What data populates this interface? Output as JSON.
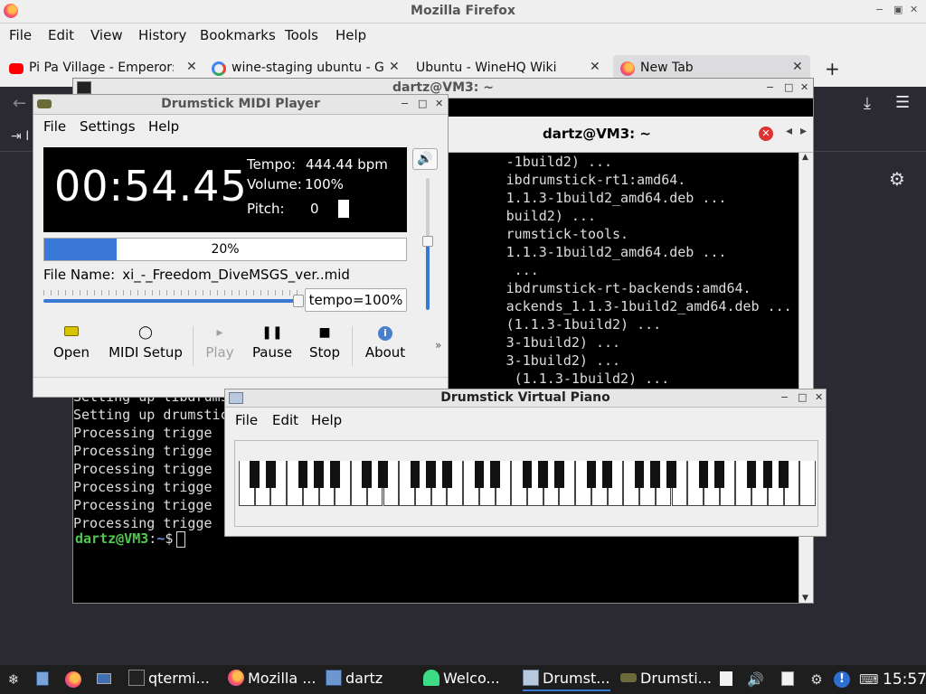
{
  "firefox": {
    "title": "Mozilla Firefox",
    "menu": [
      "File",
      "Edit",
      "View",
      "History",
      "Bookmarks",
      "Tools",
      "Help"
    ],
    "tabs": [
      {
        "label": "Pi Pa Village - Emperor: R",
        "favicon": "youtube-icon"
      },
      {
        "label": "wine-staging ubuntu - Go",
        "favicon": "google-icon"
      },
      {
        "label": "Ubuntu - WineHQ Wiki",
        "favicon": "none"
      },
      {
        "label": "New Tab",
        "favicon": "firefox-icon"
      }
    ],
    "newtab_symbol": "+",
    "import_label": "I"
  },
  "terminal": {
    "title": "dartz@VM3: ~",
    "tab_title": "dartz@VM3: ~",
    "lines": [
      "                                                     -1build2) ...",
      "                                                     ibdrumstick-rt1:amd64.",
      "                                                     1.1.3-1build2_amd64.deb ...",
      "                                                     build2) ...",
      "                                                     rumstick-tools.",
      "                                                     1.1.3-1build2_amd64.deb ...",
      "                                                      ...",
      "                                                     ibdrumstick-rt-backends:amd64.",
      "                                                     ackends_1.1.3-1build2_amd64.deb ...",
      "                                                     (1.1.3-1build2) ...",
      "                                                     3-1build2) ...",
      "                                                     3-1build2) ...",
      "                                                      (1.1.3-1build2) ...",
      "Setting up libdrumstick",
      "Setting up drumstick",
      "Processing trigge",
      "Processing trigge",
      "Processing trigge",
      "Processing trigge",
      "Processing trigge",
      "Processing trigge"
    ],
    "prompt_user": "dartz@VM3",
    "prompt_sep": ":",
    "prompt_dir": "~",
    "prompt_end": "$"
  },
  "midi_player": {
    "title": "Drumstick MIDI Player",
    "menu": [
      "File",
      "Settings",
      "Help"
    ],
    "time": "00:54.45",
    "tempo_label": "Tempo:",
    "tempo_value": "444.44 bpm",
    "volume_label": "Volume:",
    "volume_value": "100%",
    "pitch_label": "Pitch:",
    "pitch_value": "0",
    "progress": 0.2,
    "progress_text": "20%",
    "file_label": "File Name:",
    "file_value": "xi_-_Freedom_DiveMSGS_ver..mid",
    "tempo_slider": "tempo=100%",
    "tempo_slider_level": 1.0,
    "volume_level": 0.52,
    "toolbar": [
      {
        "label": "Open",
        "icon": "folder-icon",
        "enabled": true
      },
      {
        "label": "MIDI Setup",
        "icon": "midi-setup-icon",
        "enabled": true
      },
      {
        "label": "Play",
        "icon": "play-icon",
        "enabled": false
      },
      {
        "label": "Pause",
        "icon": "pause-icon",
        "enabled": true
      },
      {
        "label": "Stop",
        "icon": "stop-icon",
        "enabled": true
      },
      {
        "label": "About",
        "icon": "info-icon",
        "enabled": true
      }
    ],
    "more": "»"
  },
  "piano": {
    "title": "Drumstick Virtual Piano",
    "menu": [
      "File",
      "Edit",
      "Help"
    ],
    "white_keys": 36
  },
  "taskbar": {
    "items": [
      {
        "label": "qtermi...",
        "icon": "terminal-icon"
      },
      {
        "label": "Mozilla ...",
        "icon": "firefox-icon"
      },
      {
        "label": "dartz",
        "icon": "folder-icon"
      },
      {
        "label": "Welco...",
        "icon": "android-icon"
      },
      {
        "label": "Drumst...",
        "icon": "window-icon"
      },
      {
        "label": "Drumsti...",
        "icon": "drumstick-icon"
      }
    ],
    "clock": "15:57"
  },
  "colors": {
    "accent": "#3a78d6",
    "prompt_user": "#4ec94e",
    "prompt_dir": "#6a8fd8"
  }
}
